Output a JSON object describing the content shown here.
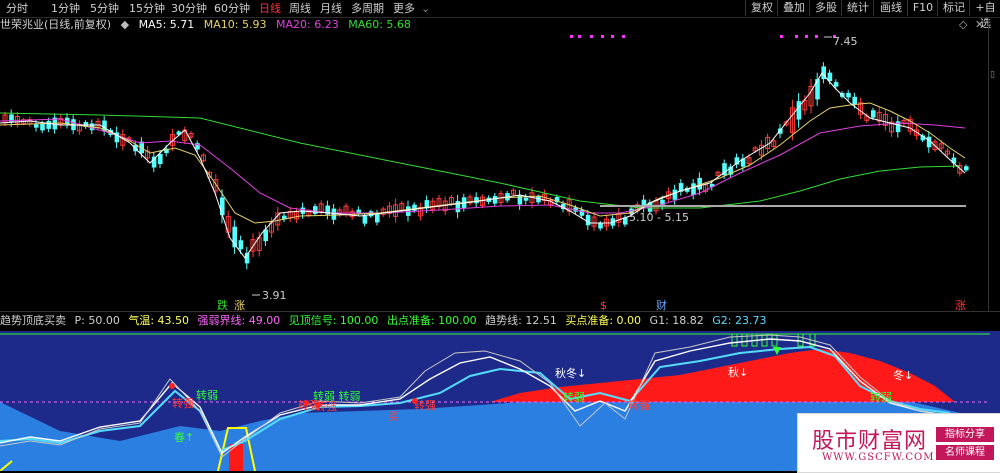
{
  "toolbar": {
    "tabs": [
      "分时",
      "1分钟",
      "5分钟",
      "15分钟",
      "30分钟",
      "60分钟",
      "日线",
      "周线",
      "月线",
      "多周期",
      "更多"
    ],
    "active_tab": "日线",
    "buttons": [
      "复权",
      "叠加",
      "多股",
      "统计",
      "画线",
      "F10",
      "标记",
      "+自选"
    ]
  },
  "main_chart": {
    "stock_title": "世荣兆业(日线,前复权)",
    "ma": [
      {
        "label": "MA5: 5.71",
        "color": "#ffffff"
      },
      {
        "label": "MA10: 5.93",
        "color": "#e8d36a"
      },
      {
        "label": "MA20: 6.23",
        "color": "#e040e0"
      },
      {
        "label": "MA60: 5.68",
        "color": "#33dd33"
      }
    ],
    "annotations": {
      "high": "7.45",
      "low": "3.91",
      "range": "5.10 - 5.15",
      "marker_die": "跌",
      "marker_zhang_left": "涨",
      "marker_s": "$",
      "marker_cai": "财",
      "marker_zhang_right": "涨"
    },
    "colors": {
      "up": "#ff3b3b",
      "down": "#54ffff",
      "ma5": "#ffffff",
      "ma10": "#e8d36a",
      "ma20": "#e040e0",
      "ma60": "#33dd33"
    }
  },
  "indicator": {
    "name": "趋势顶底买卖",
    "params": [
      {
        "label": "P: 50.00",
        "color": "#d0d0d0"
      },
      {
        "label": "气温: 43.50",
        "color": "#ffff55"
      },
      {
        "label": "强弱界线: 49.00",
        "color": "#ff66ff"
      },
      {
        "label": "见顶信号: 100.00",
        "color": "#33ff33"
      },
      {
        "label": "出点准备: 100.00",
        "color": "#33ff33"
      },
      {
        "label": "趋势线: 12.51",
        "color": "#d0d0d0"
      },
      {
        "label": "买点准备: 0.00",
        "color": "#ffff55"
      },
      {
        "label": "G1: 18.82",
        "color": "#d0d0d0"
      },
      {
        "label": "G2: 23.73",
        "color": "#55ddff"
      }
    ],
    "labels": {
      "spring": "春↑",
      "autumn_winter": "秋冬↓",
      "autumn": "秋↓",
      "winter": "冬↓",
      "weak": "转弱",
      "weak_pair": "转弱 转弱",
      "strong": "转强",
      "buy": "买"
    }
  },
  "watermark": {
    "title": "股市财富网",
    "url": "WWW.GSCFW.COM",
    "tag1": "指标分享",
    "tag2": "名师课程"
  }
}
